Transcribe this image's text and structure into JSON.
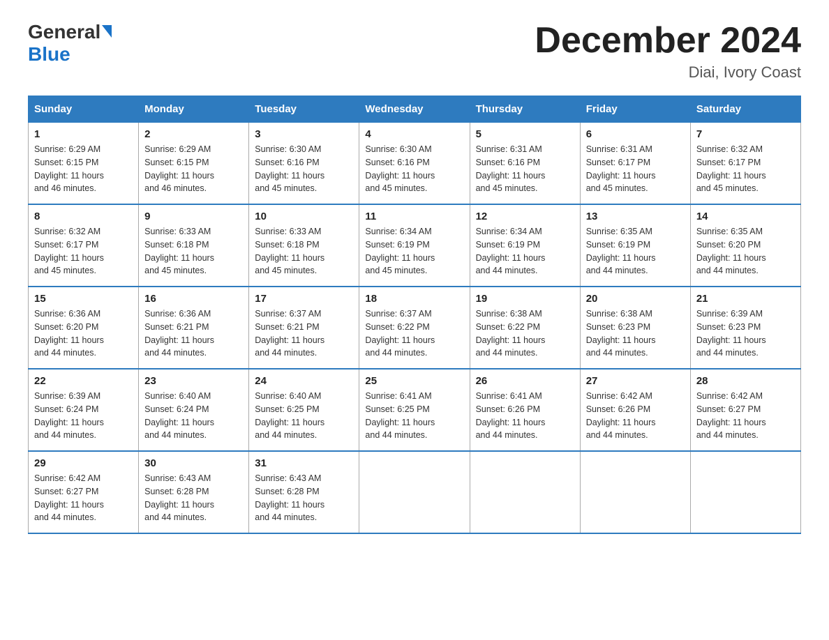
{
  "header": {
    "logo_general": "General",
    "logo_blue": "Blue",
    "month_title": "December 2024",
    "location": "Diai, Ivory Coast"
  },
  "days_of_week": [
    "Sunday",
    "Monday",
    "Tuesday",
    "Wednesday",
    "Thursday",
    "Friday",
    "Saturday"
  ],
  "weeks": [
    [
      {
        "day": "1",
        "sunrise": "6:29 AM",
        "sunset": "6:15 PM",
        "daylight": "11 hours and 46 minutes."
      },
      {
        "day": "2",
        "sunrise": "6:29 AM",
        "sunset": "6:15 PM",
        "daylight": "11 hours and 46 minutes."
      },
      {
        "day": "3",
        "sunrise": "6:30 AM",
        "sunset": "6:16 PM",
        "daylight": "11 hours and 45 minutes."
      },
      {
        "day": "4",
        "sunrise": "6:30 AM",
        "sunset": "6:16 PM",
        "daylight": "11 hours and 45 minutes."
      },
      {
        "day": "5",
        "sunrise": "6:31 AM",
        "sunset": "6:16 PM",
        "daylight": "11 hours and 45 minutes."
      },
      {
        "day": "6",
        "sunrise": "6:31 AM",
        "sunset": "6:17 PM",
        "daylight": "11 hours and 45 minutes."
      },
      {
        "day": "7",
        "sunrise": "6:32 AM",
        "sunset": "6:17 PM",
        "daylight": "11 hours and 45 minutes."
      }
    ],
    [
      {
        "day": "8",
        "sunrise": "6:32 AM",
        "sunset": "6:17 PM",
        "daylight": "11 hours and 45 minutes."
      },
      {
        "day": "9",
        "sunrise": "6:33 AM",
        "sunset": "6:18 PM",
        "daylight": "11 hours and 45 minutes."
      },
      {
        "day": "10",
        "sunrise": "6:33 AM",
        "sunset": "6:18 PM",
        "daylight": "11 hours and 45 minutes."
      },
      {
        "day": "11",
        "sunrise": "6:34 AM",
        "sunset": "6:19 PM",
        "daylight": "11 hours and 45 minutes."
      },
      {
        "day": "12",
        "sunrise": "6:34 AM",
        "sunset": "6:19 PM",
        "daylight": "11 hours and 44 minutes."
      },
      {
        "day": "13",
        "sunrise": "6:35 AM",
        "sunset": "6:19 PM",
        "daylight": "11 hours and 44 minutes."
      },
      {
        "day": "14",
        "sunrise": "6:35 AM",
        "sunset": "6:20 PM",
        "daylight": "11 hours and 44 minutes."
      }
    ],
    [
      {
        "day": "15",
        "sunrise": "6:36 AM",
        "sunset": "6:20 PM",
        "daylight": "11 hours and 44 minutes."
      },
      {
        "day": "16",
        "sunrise": "6:36 AM",
        "sunset": "6:21 PM",
        "daylight": "11 hours and 44 minutes."
      },
      {
        "day": "17",
        "sunrise": "6:37 AM",
        "sunset": "6:21 PM",
        "daylight": "11 hours and 44 minutes."
      },
      {
        "day": "18",
        "sunrise": "6:37 AM",
        "sunset": "6:22 PM",
        "daylight": "11 hours and 44 minutes."
      },
      {
        "day": "19",
        "sunrise": "6:38 AM",
        "sunset": "6:22 PM",
        "daylight": "11 hours and 44 minutes."
      },
      {
        "day": "20",
        "sunrise": "6:38 AM",
        "sunset": "6:23 PM",
        "daylight": "11 hours and 44 minutes."
      },
      {
        "day": "21",
        "sunrise": "6:39 AM",
        "sunset": "6:23 PM",
        "daylight": "11 hours and 44 minutes."
      }
    ],
    [
      {
        "day": "22",
        "sunrise": "6:39 AM",
        "sunset": "6:24 PM",
        "daylight": "11 hours and 44 minutes."
      },
      {
        "day": "23",
        "sunrise": "6:40 AM",
        "sunset": "6:24 PM",
        "daylight": "11 hours and 44 minutes."
      },
      {
        "day": "24",
        "sunrise": "6:40 AM",
        "sunset": "6:25 PM",
        "daylight": "11 hours and 44 minutes."
      },
      {
        "day": "25",
        "sunrise": "6:41 AM",
        "sunset": "6:25 PM",
        "daylight": "11 hours and 44 minutes."
      },
      {
        "day": "26",
        "sunrise": "6:41 AM",
        "sunset": "6:26 PM",
        "daylight": "11 hours and 44 minutes."
      },
      {
        "day": "27",
        "sunrise": "6:42 AM",
        "sunset": "6:26 PM",
        "daylight": "11 hours and 44 minutes."
      },
      {
        "day": "28",
        "sunrise": "6:42 AM",
        "sunset": "6:27 PM",
        "daylight": "11 hours and 44 minutes."
      }
    ],
    [
      {
        "day": "29",
        "sunrise": "6:42 AM",
        "sunset": "6:27 PM",
        "daylight": "11 hours and 44 minutes."
      },
      {
        "day": "30",
        "sunrise": "6:43 AM",
        "sunset": "6:28 PM",
        "daylight": "11 hours and 44 minutes."
      },
      {
        "day": "31",
        "sunrise": "6:43 AM",
        "sunset": "6:28 PM",
        "daylight": "11 hours and 44 minutes."
      },
      null,
      null,
      null,
      null
    ]
  ],
  "labels": {
    "sunrise": "Sunrise:",
    "sunset": "Sunset:",
    "daylight": "Daylight:"
  }
}
